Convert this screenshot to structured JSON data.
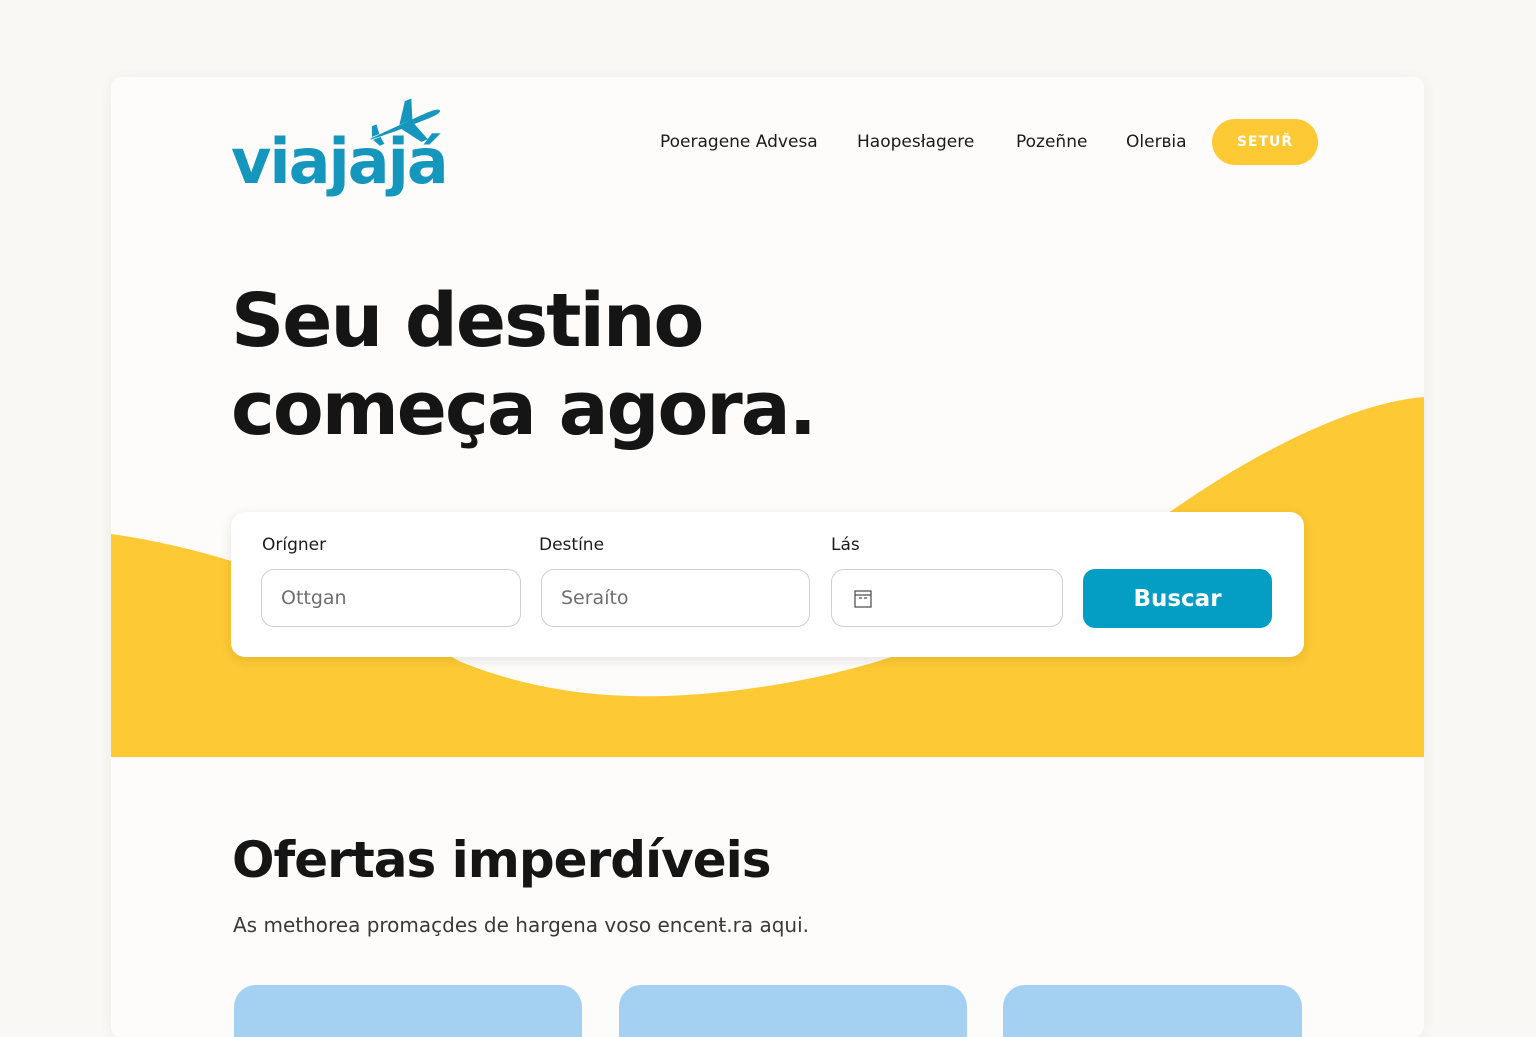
{
  "brand": {
    "name": "viajajá",
    "logo_icon": "airplane-icon",
    "logo_color": "#1596bd"
  },
  "nav": {
    "links": [
      "Poeragene Advesa",
      "Haopesłagere",
      "Pozeñne",
      "Olerʙia"
    ],
    "cta_label": "SETUŘ",
    "cta_color": "#fdc934"
  },
  "hero": {
    "title_line1": "Seu destino",
    "title_line2": "começa agora.",
    "accent_color": "#fdc934"
  },
  "search": {
    "origin_label": "Orígner",
    "origin_placeholder": "Ottgan",
    "destination_label": "Destíne",
    "destination_placeholder": "Seraíto",
    "date_label": "Lás",
    "date_icon": "calendar-icon",
    "button_label": "Buscar",
    "button_color": "#049ec4"
  },
  "offers": {
    "title": "Ofertas imperdíveis",
    "subtitle": "As methorea promaçdes de hargena voso encenŧ.ra aqui.",
    "card_color": "#a4d0f2"
  }
}
